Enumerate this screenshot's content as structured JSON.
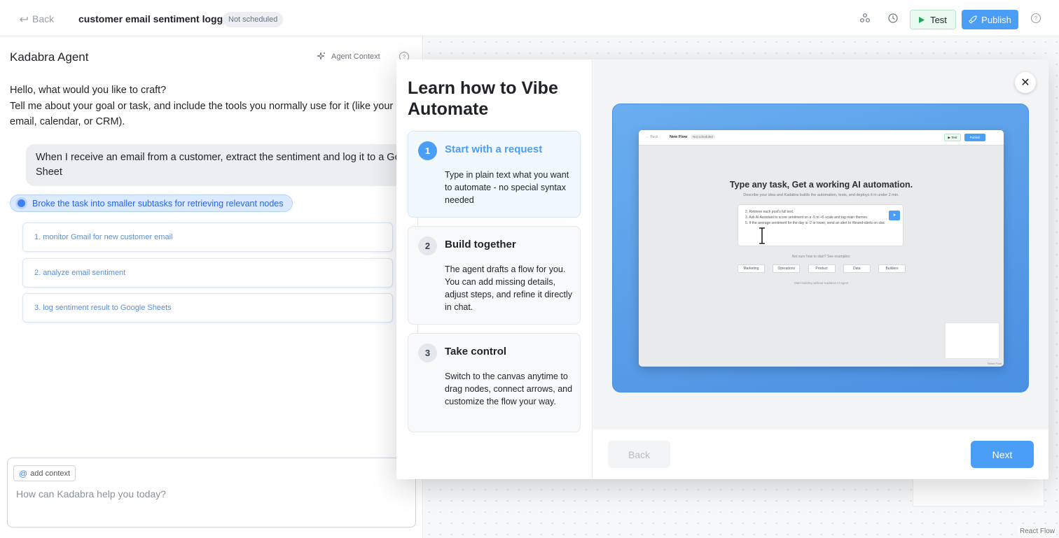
{
  "header": {
    "back_label": "Back",
    "flow_title": "customer email sentiment logger",
    "schedule_badge": "Not scheduled",
    "test_label": "Test",
    "publish_label": "Publish"
  },
  "agent_panel": {
    "title": "Kadabra Agent",
    "context_label": "Agent Context",
    "greeting_line1": "Hello, what would you like to craft?",
    "greeting_line2": "Tell me about your goal or task, and include the tools you normally use for it (like your email, calendar, or CRM).",
    "user_message": "When I receive an email from a customer, extract the sentiment and log it to a Google Sheet",
    "status_text": "Broke the task into smaller subtasks for retrieving relevant nodes",
    "subtasks": [
      "1. monitor Gmail for new customer email",
      "2. analyze email sentiment",
      "3. log sentiment result to Google Sheets"
    ],
    "add_context_label": "add context",
    "input_placeholder": "How can Kadabra help you today?"
  },
  "canvas": {
    "attribution": "React Flow"
  },
  "modal": {
    "title": "Learn how to Vibe Automate",
    "steps": [
      {
        "number": "1",
        "title": "Start with a request",
        "description": "Type in plain text what you want to automate - no special syntax needed"
      },
      {
        "number": "2",
        "title": "Build together",
        "description": "The agent drafts a flow for you. You can add missing details, adjust steps, and refine it directly in chat."
      },
      {
        "number": "3",
        "title": "Take control",
        "description": "Switch to the canvas anytime to drag nodes, connect arrows, and customize the flow your way."
      }
    ],
    "close_label": "✕",
    "back_label": "Back",
    "next_label": "Next",
    "preview": {
      "back": "← Back",
      "title": "New Flow",
      "badge": "Not scheduled",
      "test": "▶ Test",
      "publish": "Publish",
      "headline": "Type any task, Get a working AI automation.",
      "subheadline": "Describe your idea and Kadabra builds the automation, tests, and deploys it in under 2 min.",
      "box_lines": [
        "2. Retrieve each post's full text.",
        "3. Ask AI Assistant to score sentiment on a -5 to +5 scale and tag main themes.",
        "5. If the average sentiment for the day is -2 or lower, send an alert to #brand-alerts on slac"
      ],
      "hint": "Not sure how to start? See examples:",
      "chips": [
        "Marketing",
        "Operations",
        "Product",
        "Data",
        "Builders"
      ],
      "footer": "Start building without Kadabra AI agent",
      "attribution": "React Flow"
    }
  },
  "colors": {
    "accent": "#4a9ef5",
    "test_bg": "#eafaf0",
    "status_chip_bg": "#dbeafe"
  }
}
